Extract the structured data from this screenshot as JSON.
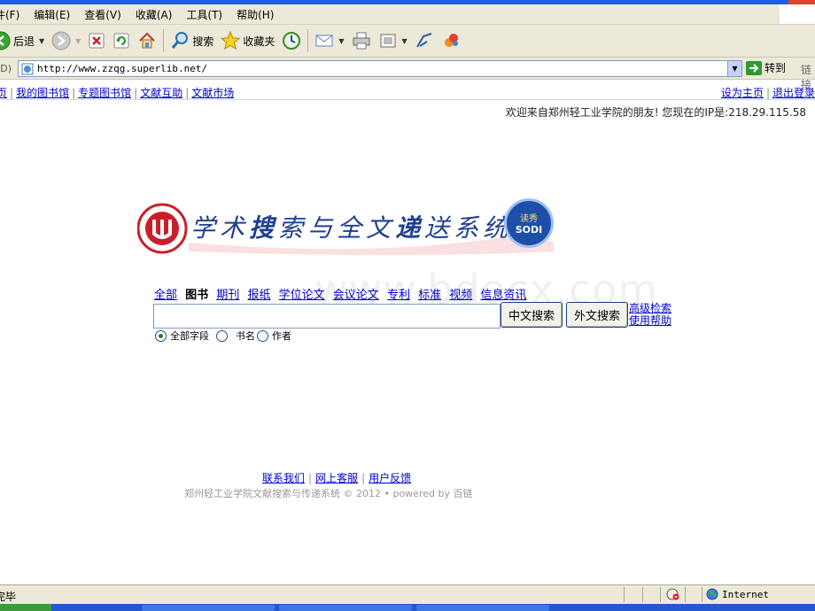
{
  "menu": {
    "items": [
      "件(F)",
      "编辑(E)",
      "查看(V)",
      "收藏(A)",
      "工具(T)",
      "帮助(H)"
    ]
  },
  "toolbar": {
    "back_label": "后退",
    "search_label": "搜索",
    "favorites_label": "收藏夹"
  },
  "address": {
    "label": "(D)",
    "url": "http://www.zzqg.superlib.net/",
    "go_label": "转到",
    "links_label": "链接"
  },
  "nav": {
    "left": [
      "页",
      "我的图书馆",
      "专题图书馆",
      "文献互助",
      "文献市场"
    ],
    "right": [
      "设为主页",
      "退出登录"
    ]
  },
  "welcome": "欢迎来自郑州轻工业学院的朋友! 您现在的IP是:218.29.115.58",
  "logo": {
    "title_chars": [
      "学",
      "术",
      "搜",
      "索",
      "与",
      "全",
      "文",
      "递",
      "送",
      "系",
      "统"
    ],
    "badge_top": "读秀",
    "badge": "SODI"
  },
  "search": {
    "tabs": [
      {
        "label": "全部",
        "active": false
      },
      {
        "label": "图书",
        "active": true
      },
      {
        "label": "期刊",
        "active": false
      },
      {
        "label": "报纸",
        "active": false
      },
      {
        "label": "学位论文",
        "active": false
      },
      {
        "label": "会议论文",
        "active": false
      },
      {
        "label": "专利",
        "active": false
      },
      {
        "label": "标准",
        "active": false
      },
      {
        "label": "视频",
        "active": false
      },
      {
        "label": "信息资讯",
        "active": false
      }
    ],
    "input_value": "",
    "chinese_button": "中文搜索",
    "foreign_button": "外文搜索",
    "advanced_link": "高级检索",
    "help_link": "使用帮助",
    "radios": [
      {
        "label": "全部字段",
        "checked": true
      },
      {
        "label": "书名",
        "checked": false
      },
      {
        "label": "作者",
        "checked": false
      }
    ]
  },
  "watermark": "www.bdocx.com",
  "footer": {
    "links": [
      "联系我们",
      "网上客服",
      "用户反馈"
    ],
    "copyright": "郑州轻工业学院文献搜索与传递系统 © 2012 • powered by 百链"
  },
  "status": {
    "text": "完毕",
    "zone": "Internet"
  },
  "colors": {
    "link": "#0000cc",
    "chrome": "#ece9d8",
    "titlebar": "#1c5fdc",
    "logo_red": "#c8202a",
    "logo_blue": "#1f3f8f"
  },
  "icons": [
    "back-arrow-icon",
    "forward-arrow-icon",
    "stop-icon",
    "refresh-icon",
    "home-icon",
    "search-icon",
    "favorites-star-icon",
    "history-icon",
    "mail-icon",
    "print-icon",
    "edit-icon",
    "messenger-icon",
    "page-icon",
    "go-arrow-icon",
    "privacy-icon",
    "globe-icon"
  ]
}
